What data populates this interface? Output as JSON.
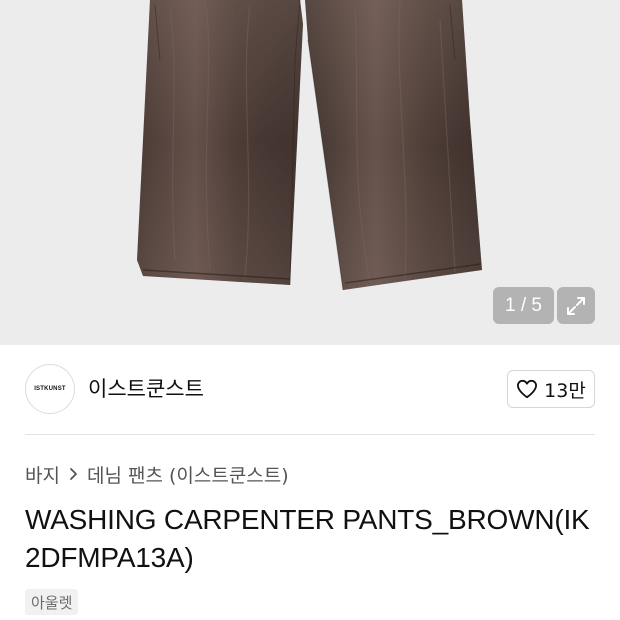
{
  "gallery": {
    "counter": "1 / 5",
    "expand_icon": "expand-icon",
    "colors": {
      "background": "#ececec",
      "denim": "#3a2a26",
      "denim_light": "#6a544c"
    }
  },
  "brand": {
    "logo_text": "ISTKUNST",
    "name": "이스트쿤스트",
    "like_icon": "heart-icon",
    "likes": "13만"
  },
  "breadcrumb": {
    "items": [
      "바지",
      "데님 팬츠 (이스트쿤스트)"
    ],
    "separator_icon": "chevron-right-icon"
  },
  "product": {
    "title": "WASHING CARPENTER PANTS_BROWN(IK2DFMPA13A)",
    "tag": "아울렛"
  }
}
